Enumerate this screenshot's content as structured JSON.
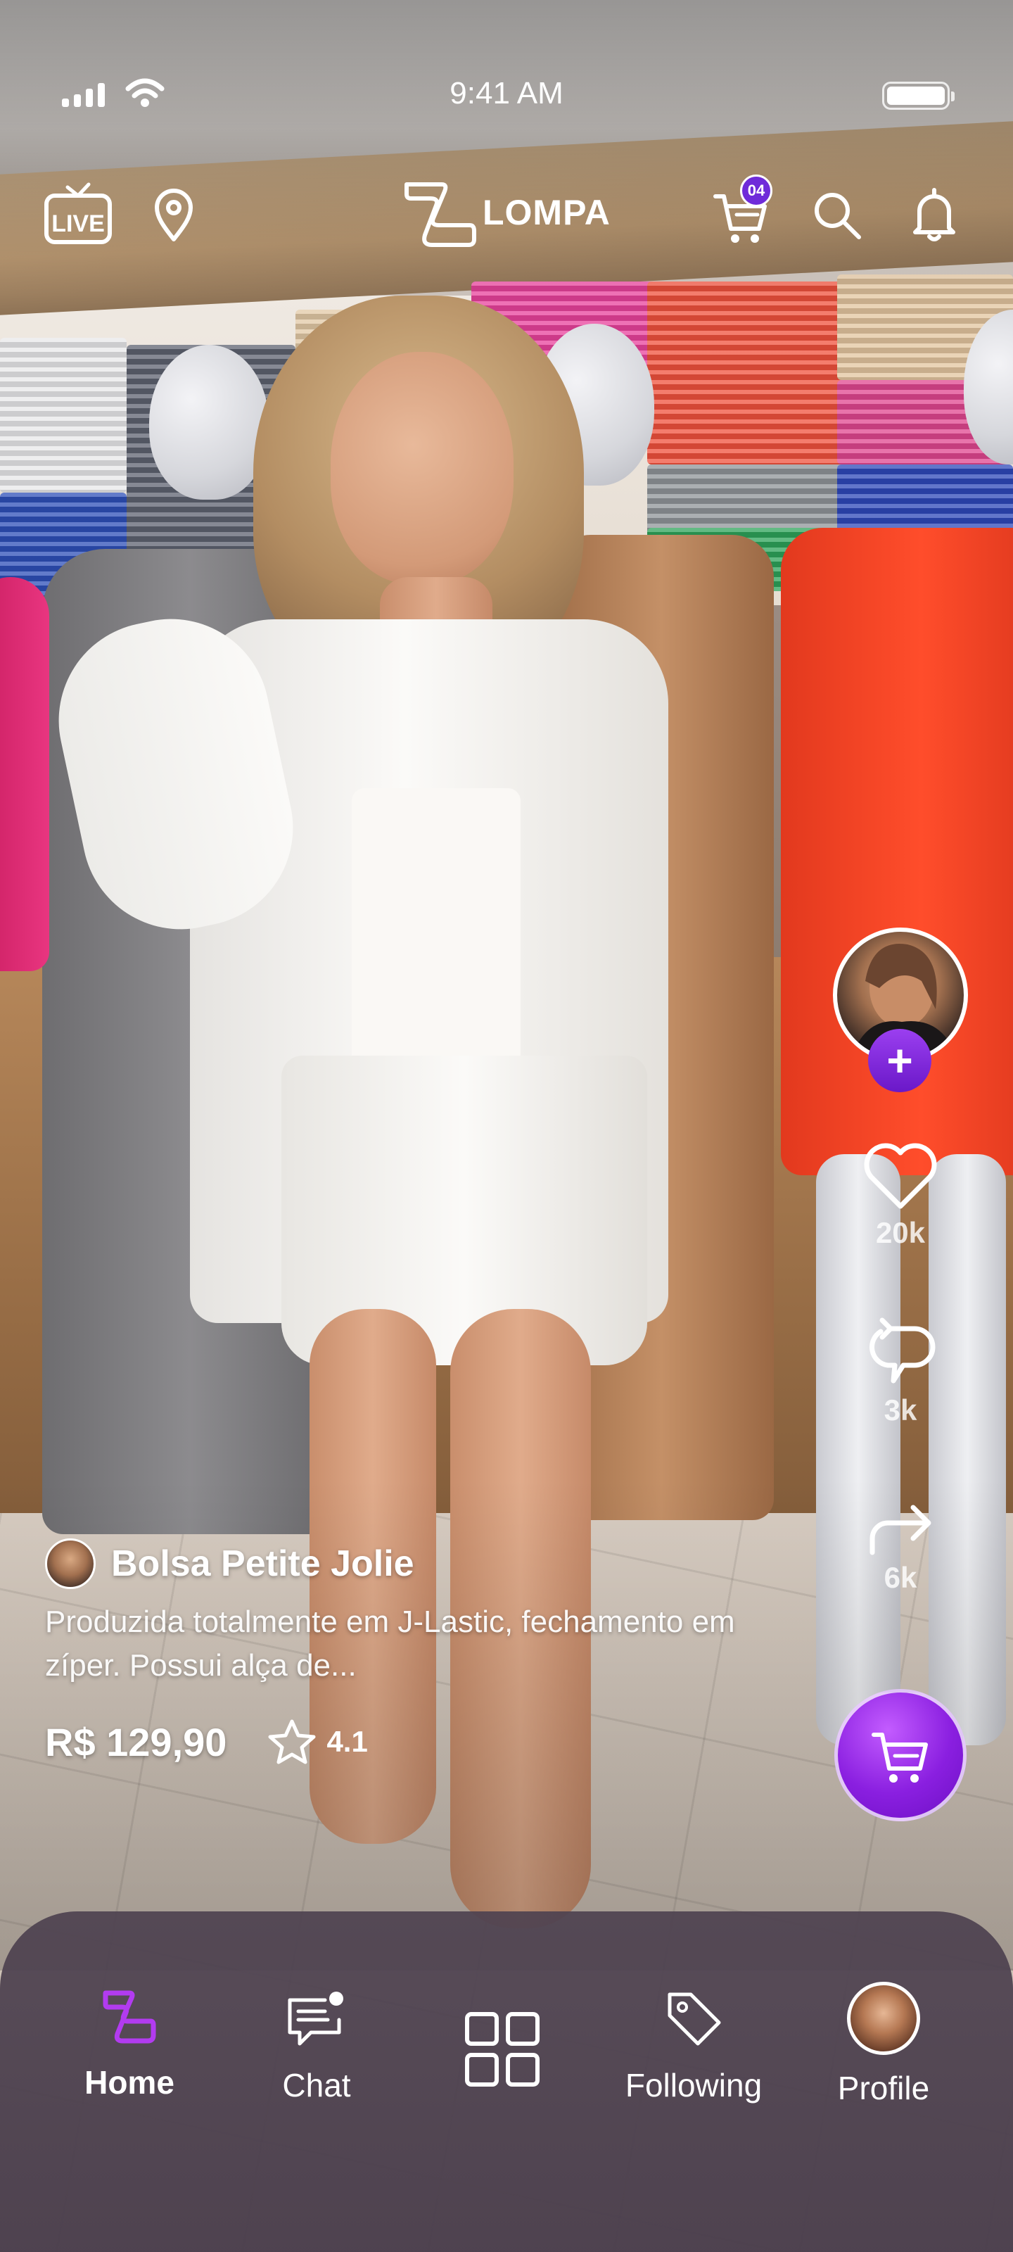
{
  "status_bar": {
    "time": "9:41 AM"
  },
  "header": {
    "live_label": "LIVE",
    "brand": "LOMPA",
    "cart_count": "04"
  },
  "actions": {
    "likes": "20k",
    "reposts": "3k",
    "shares": "6k"
  },
  "product": {
    "title": "Bolsa Petite Jolie",
    "description": "Produzida totalmente em J-Lastic, fechamento em zíper. Possui alça de...",
    "price": "R$ 129,90",
    "rating": "4.1"
  },
  "bottom_nav": {
    "items": [
      {
        "label": "Home"
      },
      {
        "label": "Chat"
      },
      {
        "label": "Following"
      },
      {
        "label": "Profile"
      }
    ]
  },
  "colors": {
    "accent": "#8a1fe0",
    "accent_dark": "#6f2bd9",
    "nav_background": "#4a3e4c",
    "home_icon": "#b23bf0"
  },
  "icons": [
    "live-tv-icon",
    "location-pin-icon",
    "lompa-logo-icon",
    "cart-icon",
    "search-icon",
    "bell-icon",
    "heart-icon",
    "repost-icon",
    "share-arrow-icon",
    "shopping-cart-icon",
    "star-icon",
    "home-icon",
    "chat-icon",
    "grid-icon",
    "tag-icon"
  ]
}
